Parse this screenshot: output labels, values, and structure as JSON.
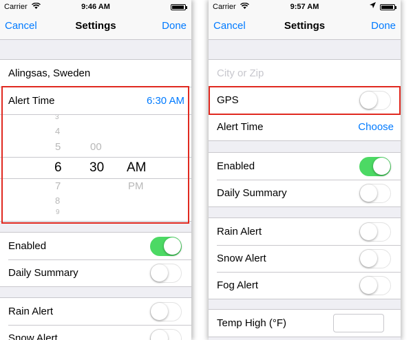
{
  "left_screen": {
    "status": {
      "carrier": "Carrier",
      "time": "9:46 AM",
      "battery_level": 0.95
    },
    "nav": {
      "cancel": "Cancel",
      "title": "Settings",
      "done": "Done"
    },
    "location": "Alingsas, Sweden",
    "alert_time": {
      "label": "Alert Time",
      "value": "6:30 AM"
    },
    "picker": {
      "hours": [
        "3",
        "4",
        "5",
        "6",
        "7",
        "8",
        "9"
      ],
      "minutes_above": "00",
      "minutes_selected": "30",
      "ampm_selected": "AM",
      "ampm_below": "PM"
    },
    "toggles": [
      {
        "label": "Enabled",
        "on": true
      },
      {
        "label": "Daily Summary",
        "on": false
      }
    ],
    "alerts": [
      {
        "label": "Rain Alert",
        "on": false
      },
      {
        "label": "Snow Alert",
        "on": false
      }
    ]
  },
  "right_screen": {
    "status": {
      "carrier": "Carrier",
      "time": "9:57 AM",
      "battery_level": 0.95
    },
    "nav": {
      "cancel": "Cancel",
      "title": "Settings",
      "done": "Done"
    },
    "city_placeholder": "City or Zip",
    "gps": {
      "label": "GPS",
      "on": false
    },
    "alert_time": {
      "label": "Alert Time",
      "value": "Choose"
    },
    "toggles": [
      {
        "label": "Enabled",
        "on": true
      },
      {
        "label": "Daily Summary",
        "on": false
      }
    ],
    "alerts": [
      {
        "label": "Rain Alert",
        "on": false
      },
      {
        "label": "Snow Alert",
        "on": false
      },
      {
        "label": "Fog Alert",
        "on": false
      }
    ],
    "temp_high": {
      "label": "Temp High (°F)",
      "value": ""
    }
  },
  "colors": {
    "accent": "#007aff",
    "switch_on": "#4cd964",
    "highlight": "#e0281f"
  }
}
